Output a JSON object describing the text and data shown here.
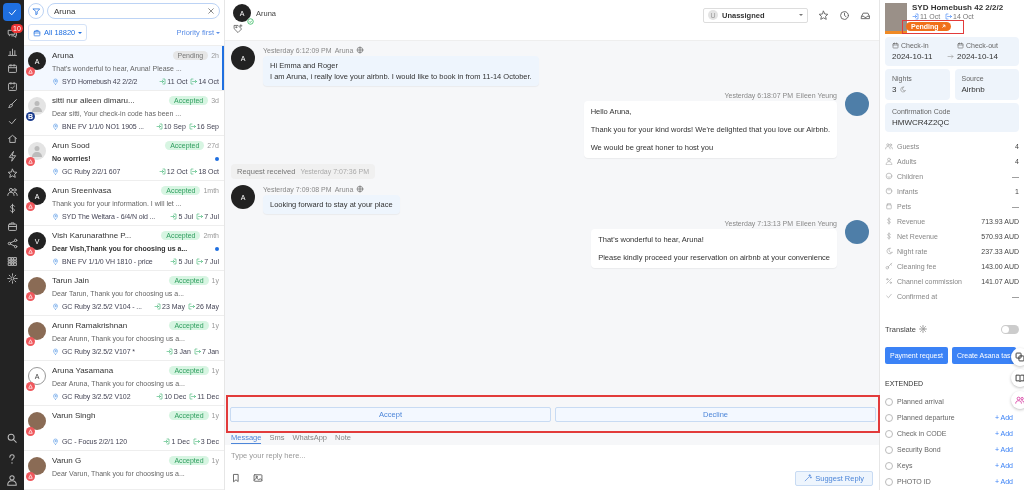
{
  "nav": {
    "badge": "10"
  },
  "search": {
    "value": "Aruna"
  },
  "filter": {
    "label": "All",
    "count": "18820",
    "sort": "Priority first"
  },
  "conversations": [
    {
      "name": "Aruna",
      "status": "Pending",
      "time": "2h",
      "preview": "That's wonderful to hear, Aruna! Please ...",
      "property": "SYD Homebush 42 2/2/2",
      "checkin": "11 Oct",
      "checkout": "14 Oct",
      "avatar": {
        "kind": "letter",
        "letter": "A"
      },
      "channel": {
        "kind": "airbnb"
      },
      "unread": false,
      "selected": true
    },
    {
      "name": "sitti nur aileen dimaru...",
      "status": "Accepted",
      "time": "3d",
      "preview": "Dear sitti, Your check-in code has been ...",
      "property": "BNE FV 1/1/0 NO1 1905 ...",
      "checkin": "10 Sep",
      "checkout": "16 Sep",
      "avatar": {
        "kind": "placeholder"
      },
      "channel": {
        "kind": "booking",
        "label": "B"
      },
      "unread": false,
      "selected": false
    },
    {
      "name": "Arun Sood",
      "status": "Accepted",
      "time": "27d",
      "preview": "No worries!",
      "property": "GC Ruby 2/2/1 607",
      "checkin": "12 Oct",
      "checkout": "18 Oct",
      "avatar": {
        "kind": "placeholder"
      },
      "channel": {
        "kind": "airbnb"
      },
      "unread": true,
      "selected": false
    },
    {
      "name": "Arun Sreenivasa",
      "status": "Accepted",
      "time": "1mth",
      "preview": "Thank you for your information. I will let ...",
      "property": "SYD The Weltara - 6/4/N old ...",
      "checkin": "5 Jul",
      "checkout": "7 Jul",
      "avatar": {
        "kind": "letter",
        "letter": "A"
      },
      "channel": {
        "kind": "airbnb"
      },
      "unread": false,
      "selected": false
    },
    {
      "name": "Vish Karunarathne P...",
      "status": "Accepted",
      "time": "2mth",
      "preview": "Dear Vish,Thank you for choosing us a...",
      "property": "BNE FV 1/1/0 VH 1810 - price",
      "checkin": "5 Jul",
      "checkout": "7 Jul",
      "avatar": {
        "kind": "letter",
        "letter": "V"
      },
      "channel": {
        "kind": "airbnb"
      },
      "unread": true,
      "selected": false
    },
    {
      "name": "Tarun Jain",
      "status": "Accepted",
      "time": "1y",
      "preview": "Dear Tarun, Thank you for choosing us a...",
      "property": "GC Ruby 3/2.5/2 V104 - ...",
      "checkin": "23 May",
      "checkout": "26 May",
      "avatar": {
        "kind": "photo"
      },
      "channel": {
        "kind": "airbnb"
      },
      "unread": false,
      "selected": false
    },
    {
      "name": "Arunn Ramakrishnan",
      "status": "Accepted",
      "time": "1y",
      "preview": "Dear Arunn, Thank you for choosing us a...",
      "property": "GC Ruby 3/2.5/2 V107 *",
      "checkin": "3 Jan",
      "checkout": "7 Jan",
      "avatar": {
        "kind": "photo"
      },
      "channel": {
        "kind": "airbnb"
      },
      "unread": false,
      "selected": false
    },
    {
      "name": "Aruna Yasamana",
      "status": "Accepted",
      "time": "1y",
      "preview": "Dear Aruna, Thank you for choosing us a...",
      "property": "GC Ruby 3/2.5/2 V102",
      "checkin": "10 Dec",
      "checkout": "11 Dec",
      "avatar": {
        "kind": "outline",
        "letter": "A"
      },
      "channel": {
        "kind": "airbnb"
      },
      "unread": false,
      "selected": false
    },
    {
      "name": "Varun Singh",
      "status": "Accepted",
      "time": "1y",
      "property": "GC - Focus 2/2/1 120",
      "checkin": "1 Dec",
      "checkout": "3 Dec",
      "avatar": {
        "kind": "photo"
      },
      "channel": {
        "kind": "airbnb"
      },
      "unread": false,
      "selected": false
    },
    {
      "name": "Varun G",
      "status": "Accepted",
      "time": "1y",
      "preview": "Dear Varun, Thank you for choosing us a...",
      "avatar": {
        "kind": "photo"
      },
      "channel": {
        "kind": "airbnb"
      },
      "unread": false,
      "selected": false
    }
  ],
  "chat": {
    "contact": {
      "name": "Aruna",
      "avatar_letter": "A",
      "verified": true
    },
    "assignee": {
      "label": "Unassigned",
      "avatar_letter": "U"
    },
    "messages": [
      {
        "kind": "incoming",
        "time": "Yesterday 6:12:09 PM",
        "sender": "Aruna",
        "avatar_letter": "A",
        "lines": [
          "Hi Emma and Roger",
          "I am Aruna, i really love your airbnb. I would like to book in from 11-14 October."
        ]
      },
      {
        "kind": "outgoing",
        "time": "Yesterday 6:18:07 PM",
        "sender": "Eileen Yeung",
        "lines": [
          "Hello Aruna,",
          "Thank you for your kind words! We're delighted that you love our Airbnb.",
          "We would be great honer to host you"
        ]
      },
      {
        "kind": "event",
        "text": "Request received",
        "time": "Yesterday 7:07:36 PM"
      },
      {
        "kind": "incoming",
        "time": "Yesterday 7:09:08 PM",
        "sender": "Aruna",
        "avatar_letter": "A",
        "lines": [
          "Looking forward to stay at your place"
        ]
      },
      {
        "kind": "outgoing",
        "time": "Yesterday 7:13:13 PM",
        "sender": "Eileen Yeung",
        "lines": [
          "That's wonderful to hear, Aruna!",
          "Please kindly proceed your reservation on airbnb at your convenience"
        ]
      }
    ],
    "actions": {
      "highlighted": true,
      "buttons": [
        "Accept",
        "Decline"
      ]
    },
    "compose_tabs": [
      {
        "label": "Message",
        "selected": true
      },
      {
        "label": "Sms",
        "selected": false
      },
      {
        "label": "WhatsApp",
        "selected": false
      },
      {
        "label": "Note",
        "selected": false
      }
    ],
    "reply": {
      "placeholder": "Type your reply here..."
    },
    "suggest_button": "Suggest Reply"
  },
  "reservation": {
    "title": "SYD Homebush 42 2/2/2",
    "checkin": "11 Oct",
    "checkout": "14 Oct",
    "status": "Pending",
    "highlighted": true,
    "checkin_label": "Check-in",
    "checkin_date": "2024-10-11",
    "checkout_label": "Check-out",
    "checkout_date": "2024-10-14",
    "nights_label": "Nights",
    "nights": "3",
    "source_label": "Source",
    "source": "Airbnb",
    "code_label": "Confirmation Code",
    "code": "HMWCR4Z2QC"
  },
  "details": [
    {
      "label": "Guests",
      "value": "4"
    },
    {
      "label": "Adults",
      "value": "4"
    },
    {
      "label": "Children",
      "value": "—"
    },
    {
      "label": "Infants",
      "value": "1"
    },
    {
      "label": "Pets",
      "value": "—"
    },
    {
      "label": "Revenue",
      "value": "713.93 AUD"
    },
    {
      "label": "Net Revenue",
      "value": "570.93 AUD"
    },
    {
      "label": "Night rate",
      "value": "237.33 AUD"
    },
    {
      "label": "Cleaning fee",
      "value": "143.00 AUD"
    },
    {
      "label": "Channel commission",
      "value": "141.07 AUD"
    },
    {
      "label": "Confirmed at",
      "value": "—"
    }
  ],
  "translate": {
    "label": "Translate",
    "on": false
  },
  "panel_buttons": [
    "Payment request",
    "Create Asana tas"
  ],
  "extended": {
    "heading": "EXTENDED",
    "fields": [
      {
        "label": "Planned arrival",
        "checked": false
      },
      {
        "label": "Planned departure",
        "checked": false,
        "action": "+ Add"
      },
      {
        "label": "Check in CODE",
        "checked": false,
        "action": "+ Add"
      },
      {
        "label": "Security Bond",
        "checked": false,
        "action": "+ Add"
      },
      {
        "label": "Keys",
        "checked": false,
        "action": "+ Add"
      },
      {
        "label": "PHOTO ID",
        "checked": false,
        "action": "+ Add"
      }
    ]
  }
}
